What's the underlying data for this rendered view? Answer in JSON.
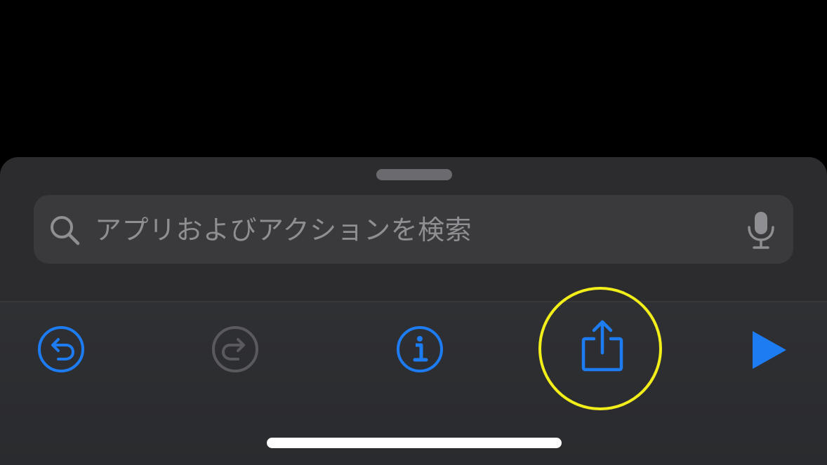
{
  "search": {
    "placeholder": "アプリおよびアクションを検索"
  },
  "toolbar": {
    "buttons": [
      {
        "name": "undo",
        "icon": "undo-icon",
        "enabled": true
      },
      {
        "name": "redo",
        "icon": "redo-icon",
        "enabled": false
      },
      {
        "name": "info",
        "icon": "info-icon",
        "enabled": true
      },
      {
        "name": "share",
        "icon": "share-icon",
        "enabled": true,
        "highlighted": true
      },
      {
        "name": "run",
        "icon": "play-icon",
        "enabled": true
      }
    ]
  },
  "colors": {
    "background": "#000000",
    "sheet": "#2c2c2e",
    "search_field": "#3a3a3c",
    "placeholder_text": "#8e8e93",
    "accent_blue": "#1e7cf2",
    "disabled_gray": "#5a5a5e",
    "highlight_yellow": "#f2ee1a",
    "home_indicator": "#ffffff"
  }
}
